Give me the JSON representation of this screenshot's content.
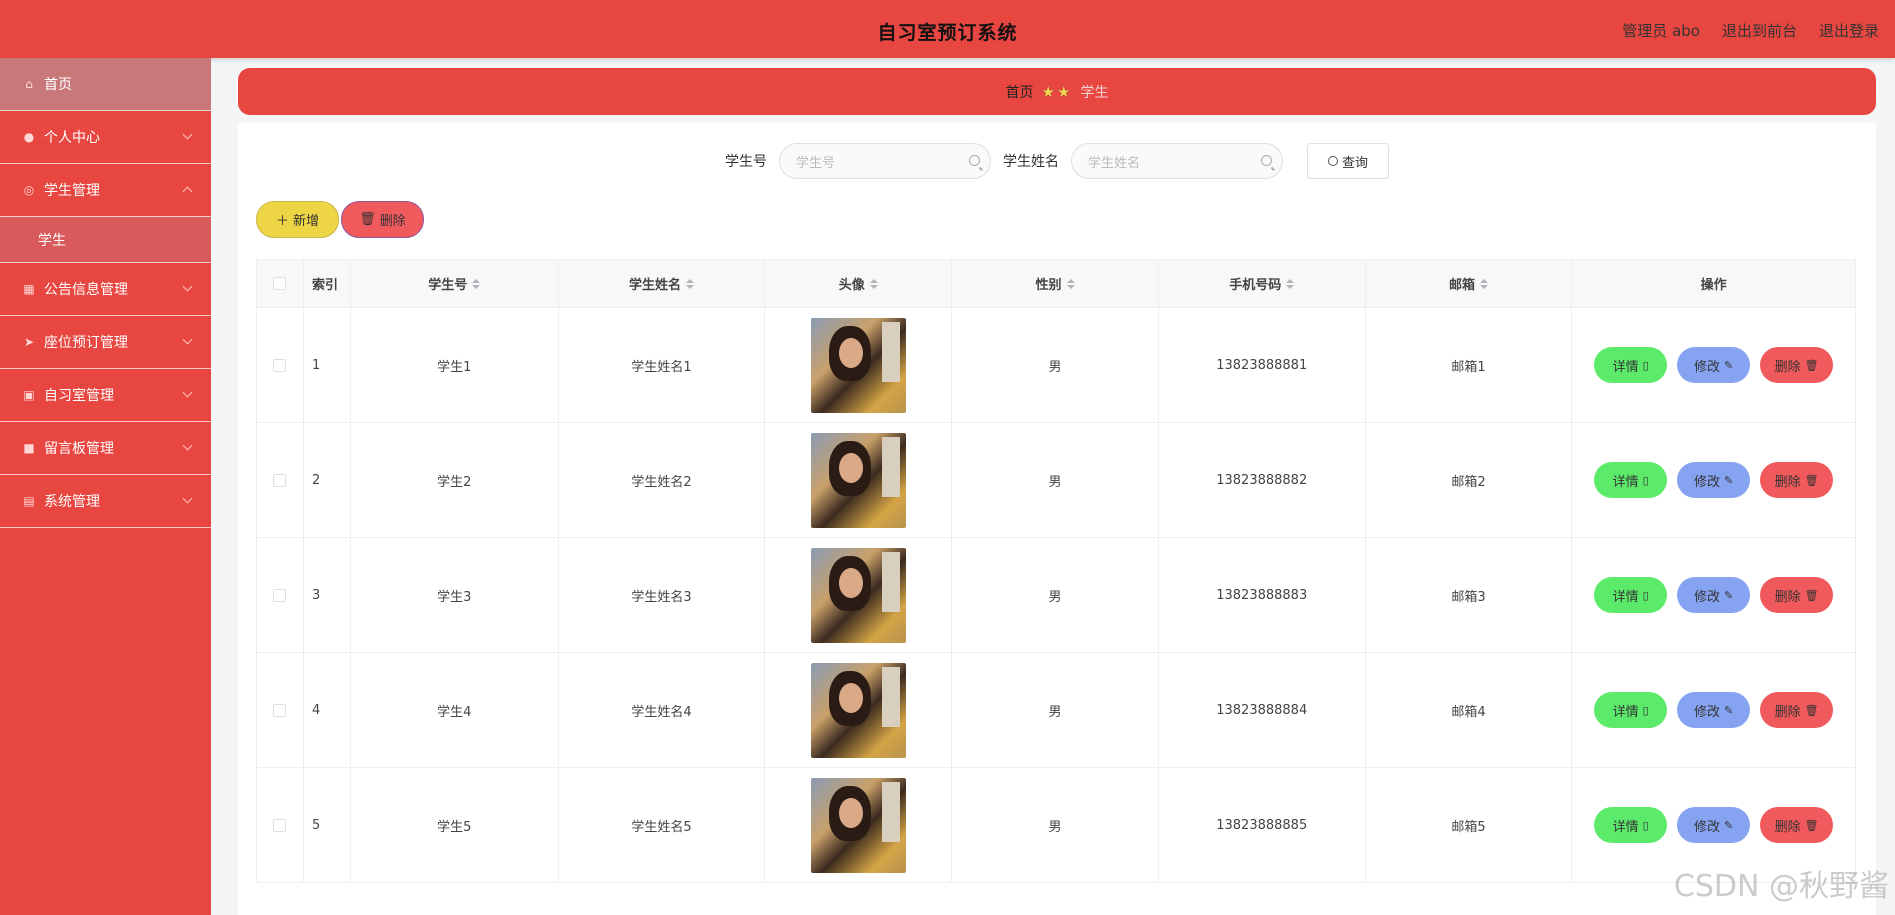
{
  "header": {
    "title": "自习室预订系统",
    "admin_label": "管理员 abo",
    "to_front": "退出到前台",
    "logout": "退出登录"
  },
  "sidebar": {
    "items": [
      {
        "label": "首页",
        "icon": "home-icon"
      },
      {
        "label": "个人中心",
        "icon": "user-icon"
      },
      {
        "label": "学生管理",
        "icon": "gauge-icon"
      },
      {
        "label": "公告信息管理",
        "icon": "grid-icon"
      },
      {
        "label": "座位预订管理",
        "icon": "send-icon"
      },
      {
        "label": "自习室管理",
        "icon": "image-icon"
      },
      {
        "label": "留言板管理",
        "icon": "video-icon"
      },
      {
        "label": "系统管理",
        "icon": "clipboard-icon"
      }
    ],
    "sub_item": "学生"
  },
  "breadcrumb": {
    "home": "首页",
    "current": "学生"
  },
  "search": {
    "student_no_label": "学生号",
    "student_no_placeholder": "学生号",
    "student_name_label": "学生姓名",
    "student_name_placeholder": "学生姓名",
    "query_button": "查询"
  },
  "actions": {
    "add": "新增",
    "delete": "删除"
  },
  "table": {
    "columns": [
      "索引",
      "学生号",
      "学生姓名",
      "头像",
      "性别",
      "手机号码",
      "邮箱",
      "操作"
    ],
    "rows": [
      {
        "index": "1",
        "no": "学生1",
        "name": "学生姓名1",
        "gender": "男",
        "phone": "13823888881",
        "email": "邮箱1"
      },
      {
        "index": "2",
        "no": "学生2",
        "name": "学生姓名2",
        "gender": "男",
        "phone": "13823888882",
        "email": "邮箱2"
      },
      {
        "index": "3",
        "no": "学生3",
        "name": "学生姓名3",
        "gender": "男",
        "phone": "13823888883",
        "email": "邮箱3"
      },
      {
        "index": "4",
        "no": "学生4",
        "name": "学生姓名4",
        "gender": "男",
        "phone": "13823888884",
        "email": "邮箱4"
      },
      {
        "index": "5",
        "no": "学生5",
        "name": "学生姓名5",
        "gender": "男",
        "phone": "13823888885",
        "email": "邮箱5"
      }
    ],
    "row_actions": {
      "view": "详情",
      "edit": "修改",
      "delete": "删除"
    }
  },
  "watermark": "CSDN @秋野酱",
  "colors": {
    "primary": "#e84640",
    "view": "#5cea6b",
    "edit": "#85a3f0",
    "delete": "#f05a5c",
    "add": "#eed545"
  }
}
